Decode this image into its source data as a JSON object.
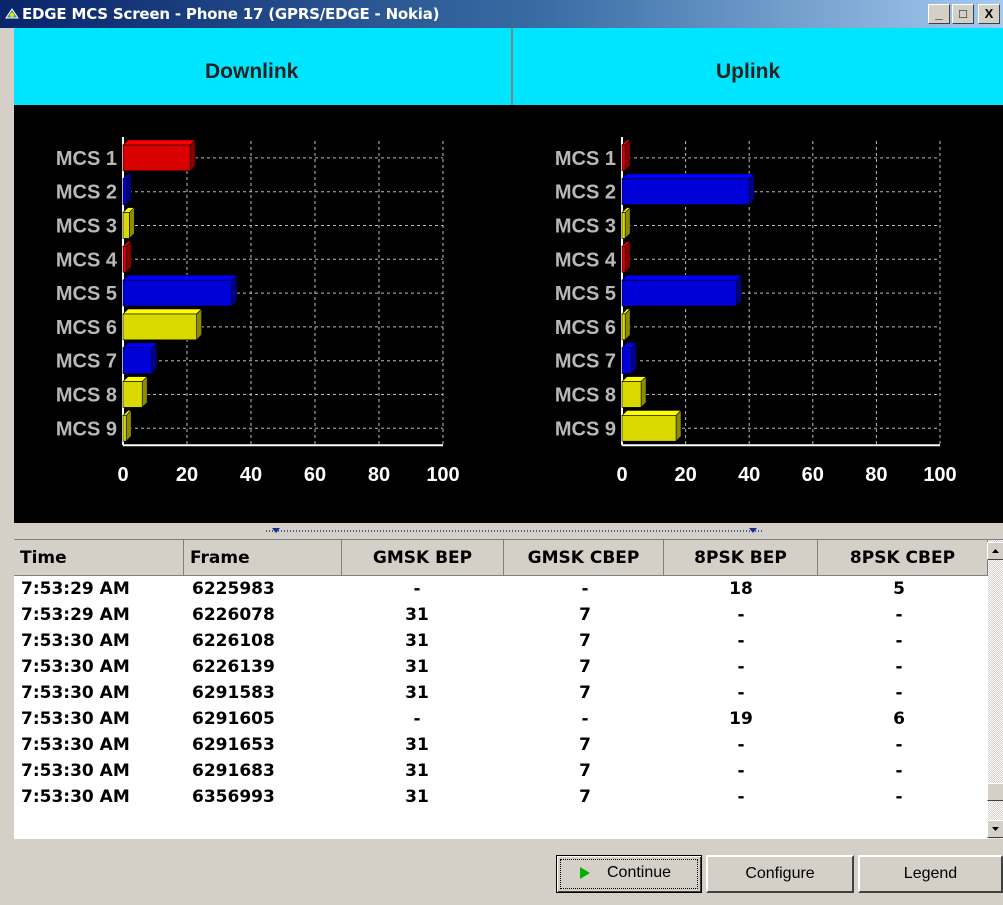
{
  "window": {
    "title": "EDGE MCS Screen - Phone 17 (GPRS/EDGE - Nokia)",
    "min": "_",
    "max": "□",
    "close": "X"
  },
  "header": {
    "downlink": "Downlink",
    "uplink": "Uplink"
  },
  "colors": {
    "mcs1": "#ff0000",
    "mcs2": "#0000ff",
    "mcs3": "#ffff00",
    "mcs4": "#ff0000",
    "mcs5": "#0000ff",
    "mcs6": "#ffff00",
    "mcs7": "#0000ff",
    "mcs8": "#ffff00",
    "mcs9": "#ffff00"
  },
  "chart_data": [
    {
      "type": "bar",
      "title": "Downlink",
      "categories": [
        "MCS 1",
        "MCS 2",
        "MCS 3",
        "MCS 4",
        "MCS 5",
        "MCS 6",
        "MCS 7",
        "MCS 8",
        "MCS 9"
      ],
      "values": [
        21,
        1,
        2,
        1,
        34,
        23,
        9,
        6,
        1
      ],
      "xlim": [
        0,
        100
      ],
      "ticks": [
        "0",
        "20",
        "40",
        "60",
        "80",
        "100"
      ],
      "orientation": "horizontal",
      "grid": true
    },
    {
      "type": "bar",
      "title": "Uplink",
      "categories": [
        "MCS 1",
        "MCS 2",
        "MCS 3",
        "MCS 4",
        "MCS 5",
        "MCS 6",
        "MCS 7",
        "MCS 8",
        "MCS 9"
      ],
      "values": [
        1,
        40,
        1,
        1,
        36,
        1,
        3,
        6,
        17
      ],
      "xlim": [
        0,
        100
      ],
      "ticks": [
        "0",
        "20",
        "40",
        "60",
        "80",
        "100"
      ],
      "orientation": "horizontal",
      "grid": true
    }
  ],
  "table": {
    "columns": [
      "Time",
      "Frame",
      "GMSK BEP",
      "GMSK CBEP",
      "8PSK BEP",
      "8PSK CBEP"
    ],
    "rows": [
      [
        "7:53:29 AM",
        "6225983",
        "-",
        "-",
        "18",
        "5"
      ],
      [
        "7:53:29 AM",
        "6226078",
        "31",
        "7",
        "-",
        "-"
      ],
      [
        "7:53:30 AM",
        "6226108",
        "31",
        "7",
        "-",
        "-"
      ],
      [
        "7:53:30 AM",
        "6226139",
        "31",
        "7",
        "-",
        "-"
      ],
      [
        "7:53:30 AM",
        "6291583",
        "31",
        "7",
        "-",
        "-"
      ],
      [
        "7:53:30 AM",
        "6291605",
        "-",
        "-",
        "19",
        "6"
      ],
      [
        "7:53:30 AM",
        "6291653",
        "31",
        "7",
        "-",
        "-"
      ],
      [
        "7:53:30 AM",
        "6291683",
        "31",
        "7",
        "-",
        "-"
      ],
      [
        "7:53:30 AM",
        "6356993",
        "31",
        "7",
        "-",
        "-"
      ]
    ]
  },
  "buttons": {
    "continue": "Continue",
    "configure": "Configure",
    "legend": "Legend"
  }
}
